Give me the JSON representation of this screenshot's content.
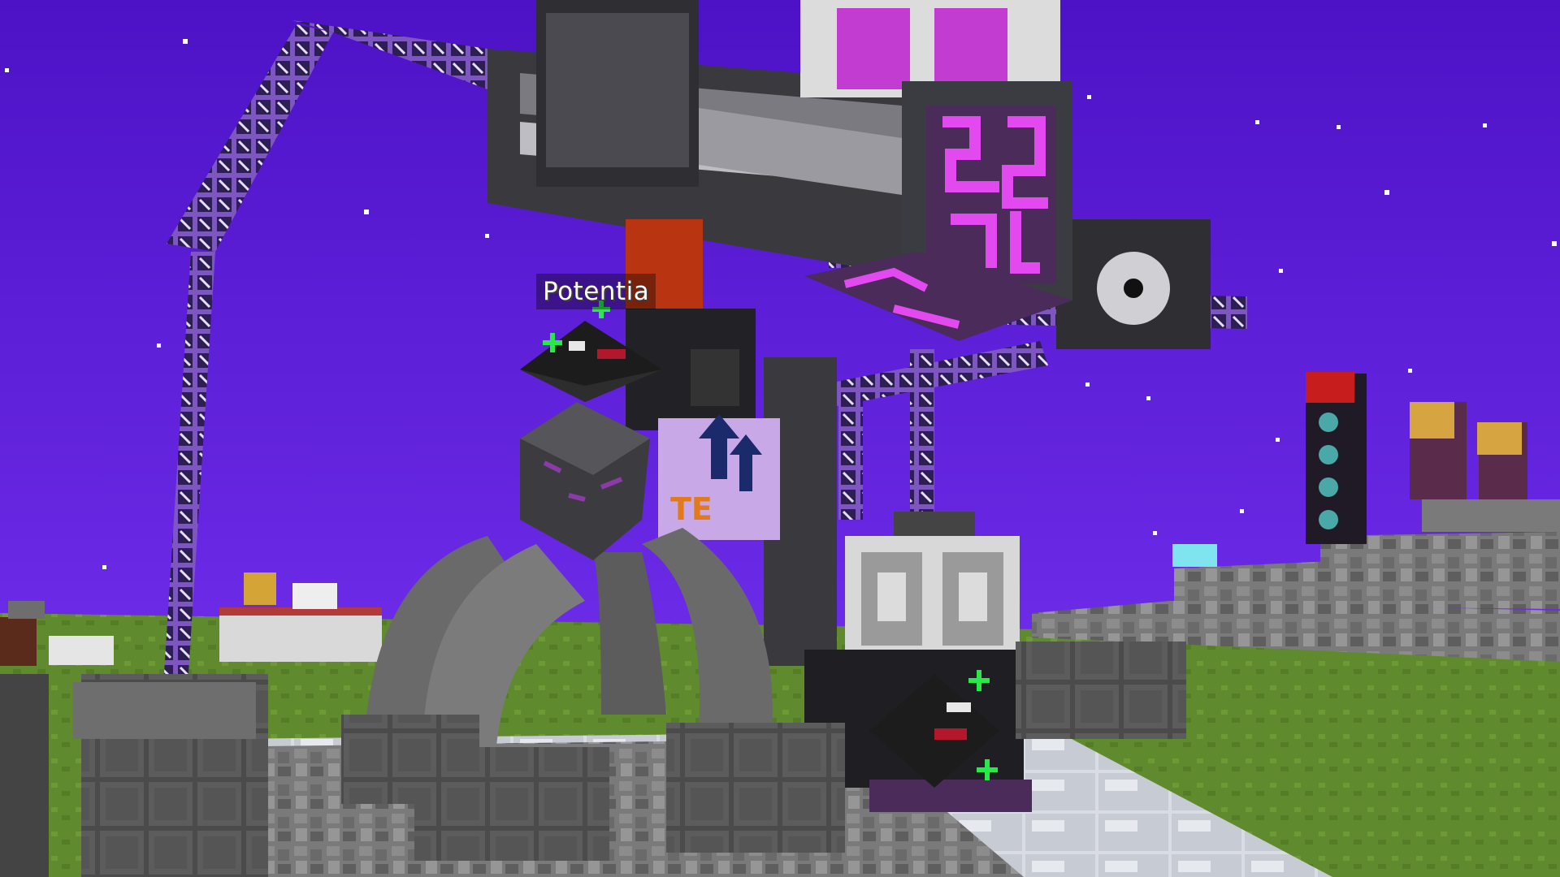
{
  "hud": {
    "entity_nametag": "Potentia"
  },
  "palette": {
    "sky": "#5a1fd6",
    "grass": "#5f8a2d",
    "stone": "#6e6e6e",
    "void_metal": "#2a2a2e",
    "eldritch_magenta": "#e24af0",
    "frame_purple": "#8a63c9"
  }
}
